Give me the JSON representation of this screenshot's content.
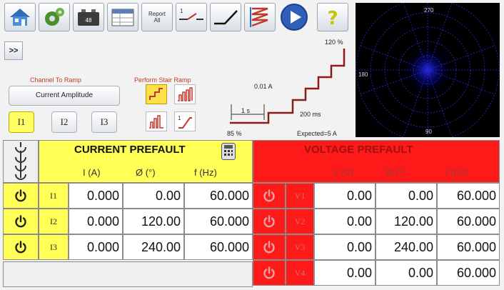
{
  "toolbar": {
    "report_line1": "Report",
    "report_line2": "All",
    "battery_label": "48",
    "step_label": "1"
  },
  "expand_label": ">>",
  "ramp": {
    "channel_title": "Channel To Ramp",
    "perform_title": "Perform Stair Ramp",
    "amplitude_button": "Current Amplitude",
    "channels": [
      "I1",
      "I2",
      "I3"
    ],
    "ramp_mode_label": "1"
  },
  "stair": {
    "top_pct": "120 %",
    "step_amp": "0.01 A",
    "step_time": "1 s",
    "dwell": "200 ms",
    "start_pct": "85 %",
    "expected": "Expected=5 A"
  },
  "polar": {
    "top": "270",
    "left": "180",
    "bottom": "90"
  },
  "current_prefault": {
    "title": "CURRENT PREFAULT",
    "cols": [
      "I (A)",
      "Ø (°)",
      "f (Hz)"
    ],
    "rows": [
      {
        "label": "I1",
        "amp": "0.000",
        "angle": "0.00",
        "freq": "60.000"
      },
      {
        "label": "I2",
        "amp": "0.000",
        "angle": "120.00",
        "freq": "60.000"
      },
      {
        "label": "I3",
        "amp": "0.000",
        "angle": "240.00",
        "freq": "60.000"
      }
    ]
  },
  "voltage_prefault": {
    "title": "VOLTAGE PREFAULT",
    "cols": [
      "V (V)",
      "Ø (°)",
      "f (Hz)"
    ],
    "rows": [
      {
        "label": "V1",
        "volt": "0.00",
        "angle": "0.00",
        "freq": "60.000"
      },
      {
        "label": "V2",
        "volt": "0.00",
        "angle": "120.00",
        "freq": "60.000"
      },
      {
        "label": "V3",
        "volt": "0.00",
        "angle": "240.00",
        "freq": "60.000"
      },
      {
        "label": "V4",
        "volt": "0.00",
        "angle": "0.00",
        "freq": "60.000"
      }
    ]
  }
}
